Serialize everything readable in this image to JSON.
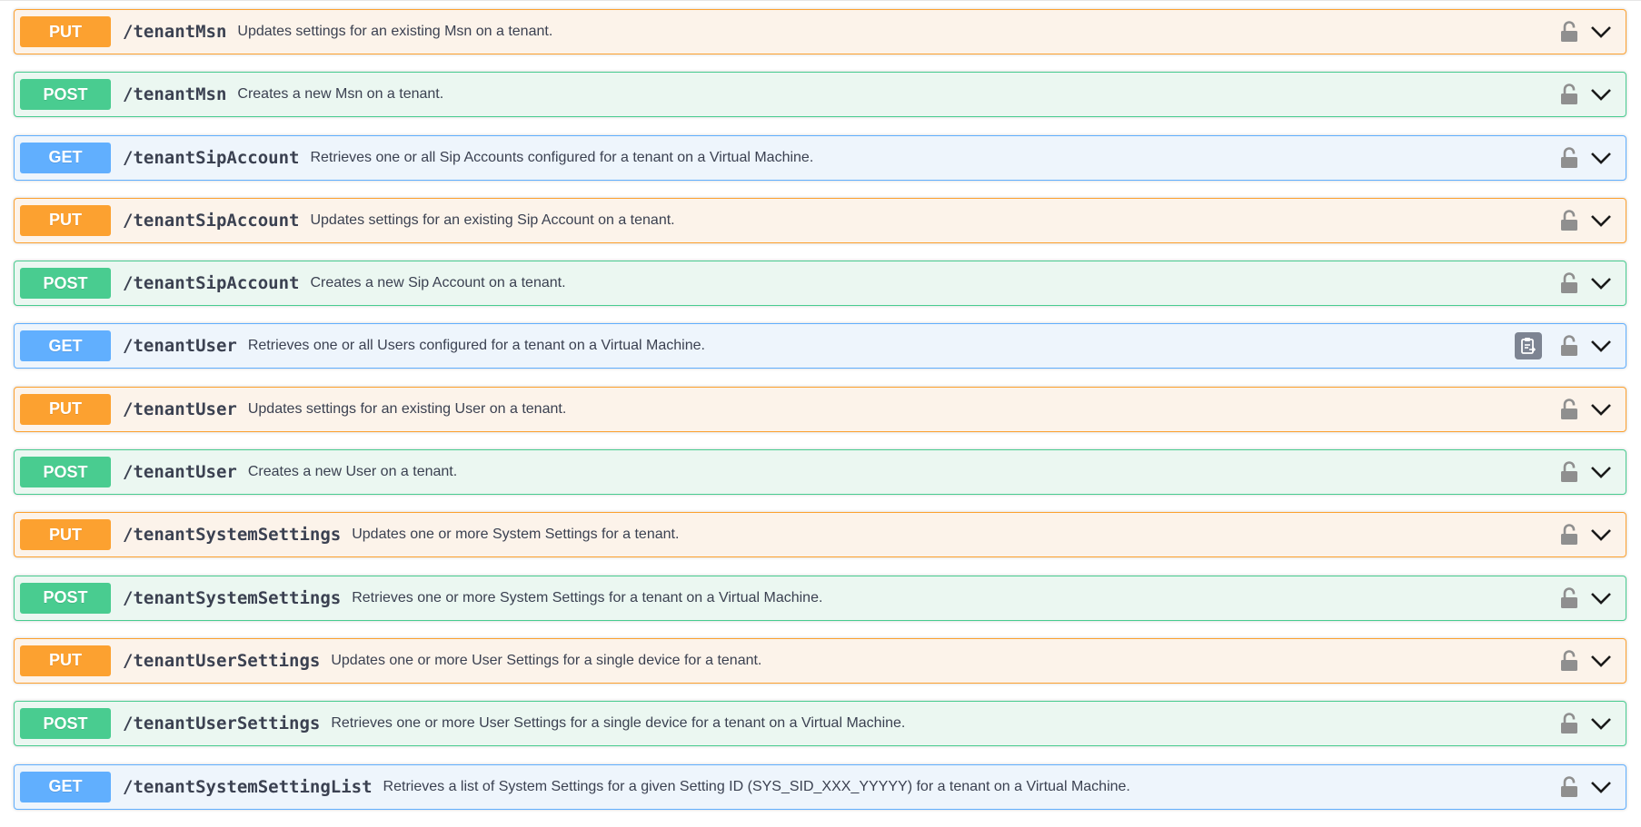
{
  "operations": [
    {
      "method": "PUT",
      "path": "/tenantMsn",
      "summary": "Updates settings for an existing Msn on a tenant.",
      "copy_visible": false
    },
    {
      "method": "POST",
      "path": "/tenantMsn",
      "summary": "Creates a new Msn on a tenant.",
      "copy_visible": false
    },
    {
      "method": "GET",
      "path": "/tenantSipAccount",
      "summary": "Retrieves one or all Sip Accounts configured for a tenant on a Virtual Machine.",
      "copy_visible": false
    },
    {
      "method": "PUT",
      "path": "/tenantSipAccount",
      "summary": "Updates settings for an existing Sip Account on a tenant.",
      "copy_visible": false
    },
    {
      "method": "POST",
      "path": "/tenantSipAccount",
      "summary": "Creates a new Sip Account on a tenant.",
      "copy_visible": false
    },
    {
      "method": "GET",
      "path": "/tenantUser",
      "summary": "Retrieves one or all Users configured for a tenant on a Virtual Machine.",
      "copy_visible": true
    },
    {
      "method": "PUT",
      "path": "/tenantUser",
      "summary": "Updates settings for an existing User on a tenant.",
      "copy_visible": false
    },
    {
      "method": "POST",
      "path": "/tenantUser",
      "summary": "Creates a new User on a tenant.",
      "copy_visible": false
    },
    {
      "method": "PUT",
      "path": "/tenantSystemSettings",
      "summary": "Updates one or more System Settings for a tenant.",
      "copy_visible": false
    },
    {
      "method": "POST",
      "path": "/tenantSystemSettings",
      "summary": "Retrieves one or more System Settings for a tenant on a Virtual Machine.",
      "copy_visible": false
    },
    {
      "method": "PUT",
      "path": "/tenantUserSettings",
      "summary": "Updates one or more User Settings for a single device for a tenant.",
      "copy_visible": false
    },
    {
      "method": "POST",
      "path": "/tenantUserSettings",
      "summary": "Retrieves one or more User Settings for a single device for a tenant on a Virtual Machine.",
      "copy_visible": false
    },
    {
      "method": "GET",
      "path": "/tenantSystemSettingList",
      "summary": "Retrieves a list of System Settings for a given Setting ID (SYS_SID_XXX_YYYYY) for a tenant on a Virtual Machine.",
      "copy_visible": false
    }
  ],
  "icons": {
    "lock": "unlocked-padlock-icon",
    "expand": "chevron-down-icon",
    "copy": "clipboard-copy-icon"
  },
  "colors": {
    "put": "#fca130",
    "post": "#49cc90",
    "get": "#61affe",
    "lock": "#8f8f8f",
    "text": "#3b4151"
  }
}
